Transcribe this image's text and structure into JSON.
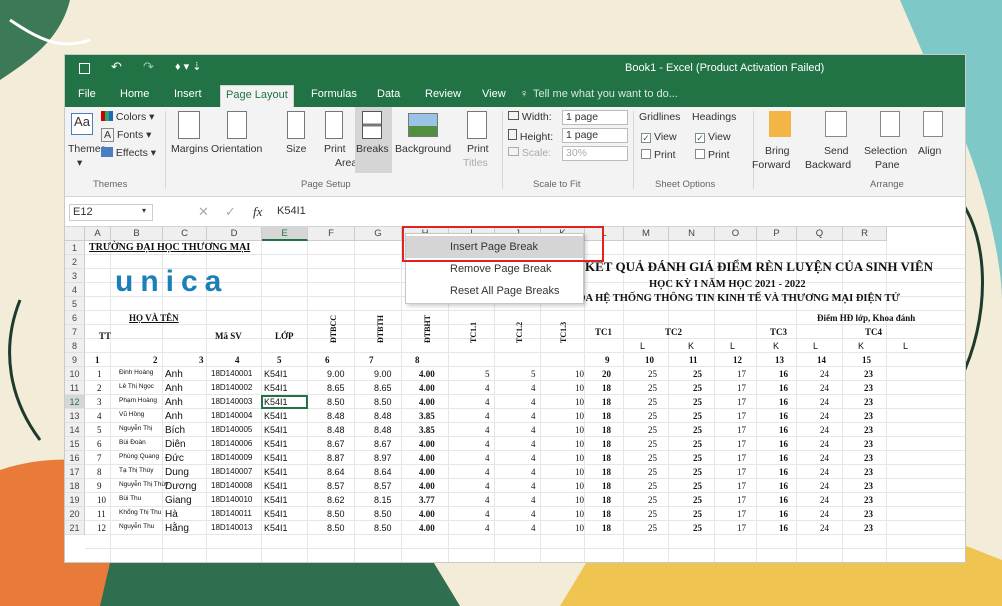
{
  "window": {
    "title": "Book1 - Excel (Product Activation Failed)"
  },
  "tabs": [
    "File",
    "Home",
    "Insert",
    "Page Layout",
    "Formulas",
    "Data",
    "Review",
    "View"
  ],
  "tell_me": "Tell me what you want to do...",
  "ribbon": {
    "themes": {
      "themes": "Themes",
      "colors": "Colors",
      "fonts": "Fonts",
      "effects": "Effects",
      "group": "Themes"
    },
    "page_setup": {
      "margins": "Margins",
      "orientation": "Orientation",
      "size": "Size",
      "print_area": "Print",
      "print_area2": "Area",
      "breaks": "Breaks",
      "background": "Background",
      "print_titles": "Print",
      "print_titles2": "Titles",
      "group": "Page Setup"
    },
    "scale": {
      "width_label": "Width:",
      "width_value": "1 page",
      "height_label": "Height:",
      "height_value": "1 page",
      "scale_label": "Scale:",
      "scale_value": "30%",
      "group": "Scale to Fit"
    },
    "sheet_options": {
      "gridlines": "Gridlines",
      "headings": "Headings",
      "view": "View",
      "print": "Print",
      "group": "Sheet Options"
    },
    "arrange": {
      "bring1": "Bring",
      "bring2": "Forward",
      "send1": "Send",
      "send2": "Backward",
      "selection1": "Selection",
      "selection2": "Pane",
      "align": "Align",
      "group": "Arrange"
    }
  },
  "formula_bar": {
    "name_box": "E12",
    "fx": "fx",
    "content": "K54I1"
  },
  "breaks_menu": [
    "Insert Page Break",
    "Remove Page Break",
    "Reset All Page Breaks"
  ],
  "columns": [
    "A",
    "B",
    "C",
    "D",
    "E",
    "F",
    "G",
    "H",
    "I",
    "J",
    "K",
    "L",
    "M",
    "N",
    "O",
    "P",
    "Q",
    "R"
  ],
  "rows": [
    "1",
    "2",
    "3",
    "4",
    "5",
    "6",
    "7",
    "8",
    "9",
    "10",
    "11",
    "12",
    "13",
    "14",
    "15",
    "16",
    "17",
    "18",
    "19",
    "20",
    "21"
  ],
  "sheet": {
    "school": "TRƯỜNG ĐẠI HỌC THƯƠNG MẠI",
    "logo": "unica",
    "title1": "KẾT QUẢ ĐÁNH GIÁ ĐIỂM RÈN LUYỆN CỦA SINH VIÊN",
    "title2": "HỌC KỲ I NĂM HỌC 2021 - 2022",
    "title3": "KHOA HỆ THỐNG THÔNG TIN KINH TẾ VÀ THƯƠNG MẠI ĐIỆN TỬ",
    "hdr": {
      "tt": "TT",
      "hoten": "HỌ VÀ TÊN",
      "masv": "Mã SV",
      "lop": "LỚP",
      "dtbcc": "ĐTBCC",
      "dtbth": "ĐTBTH",
      "dtbht": "ĐTBHT",
      "tc11": "TC1.1",
      "tc12": "TC1.2",
      "tc13": "TC1.3",
      "tc1": "TC1",
      "tc2": "TC2",
      "tc3": "TC3",
      "tc4": "TC4",
      "diem": "Điểm HĐ lớp, Khoa đánh",
      "l": "L",
      "k": "K"
    },
    "numrow": [
      "1",
      "2",
      "3",
      "4",
      "5",
      "6",
      "7",
      "8",
      "9",
      "10",
      "11",
      "12",
      "13",
      "14",
      "15"
    ],
    "data": [
      [
        "1",
        "Đinh Hoàng",
        "Anh",
        "18D140001",
        "K54I1",
        "9.00",
        "9.00",
        "4.00",
        "5",
        "5",
        "10",
        "20",
        "25",
        "25",
        "17",
        "16",
        "24",
        "23"
      ],
      [
        "2",
        "Lê Thị Ngọc",
        "Anh",
        "18D140002",
        "K54I1",
        "8.65",
        "8.65",
        "4.00",
        "4",
        "4",
        "10",
        "18",
        "25",
        "25",
        "17",
        "16",
        "24",
        "23"
      ],
      [
        "3",
        "Phạm Hoàng",
        "Anh",
        "18D140003",
        "K54I1",
        "8.50",
        "8.50",
        "4.00",
        "4",
        "4",
        "10",
        "18",
        "25",
        "25",
        "17",
        "16",
        "24",
        "23"
      ],
      [
        "4",
        "Vũ Hồng",
        "Anh",
        "18D140004",
        "K54I1",
        "8.48",
        "8.48",
        "3.85",
        "4",
        "4",
        "10",
        "18",
        "25",
        "25",
        "17",
        "16",
        "24",
        "23"
      ],
      [
        "5",
        "Nguyễn Thị",
        "Bích",
        "18D140005",
        "K54I1",
        "8.48",
        "8.48",
        "3.85",
        "4",
        "4",
        "10",
        "18",
        "25",
        "25",
        "17",
        "16",
        "24",
        "23"
      ],
      [
        "6",
        "Bùi Đoàn",
        "Diên",
        "18D140006",
        "K54I1",
        "8.67",
        "8.67",
        "4.00",
        "4",
        "4",
        "10",
        "18",
        "25",
        "25",
        "17",
        "16",
        "24",
        "23"
      ],
      [
        "7",
        "Phùng Quang",
        "Đức",
        "18D140009",
        "K54I1",
        "8.87",
        "8.97",
        "4.00",
        "4",
        "4",
        "10",
        "18",
        "25",
        "25",
        "17",
        "16",
        "24",
        "23"
      ],
      [
        "8",
        "Tạ Thị Thùy",
        "Dung",
        "18D140007",
        "K54I1",
        "8.64",
        "8.64",
        "4.00",
        "4",
        "4",
        "10",
        "18",
        "25",
        "25",
        "17",
        "16",
        "24",
        "23"
      ],
      [
        "9",
        "Nguyễn Thị Thùy",
        "Dương",
        "18D140008",
        "K54I1",
        "8.57",
        "8.57",
        "4.00",
        "4",
        "4",
        "10",
        "18",
        "25",
        "25",
        "17",
        "16",
        "24",
        "23"
      ],
      [
        "10",
        "Bùi Thu",
        "Giang",
        "18D140010",
        "K54I1",
        "8.62",
        "8.15",
        "3.77",
        "4",
        "4",
        "10",
        "18",
        "25",
        "25",
        "17",
        "16",
        "24",
        "23"
      ],
      [
        "11",
        "Khổng Thị Thu",
        "Hà",
        "18D140011",
        "K54I1",
        "8.50",
        "8.50",
        "4.00",
        "4",
        "4",
        "10",
        "18",
        "25",
        "25",
        "17",
        "16",
        "24",
        "23"
      ],
      [
        "12",
        "Nguyễn Thu",
        "Hằng",
        "18D140013",
        "K54I1",
        "8.50",
        "8.50",
        "4.00",
        "4",
        "4",
        "10",
        "18",
        "25",
        "25",
        "17",
        "16",
        "24",
        "23"
      ]
    ]
  }
}
